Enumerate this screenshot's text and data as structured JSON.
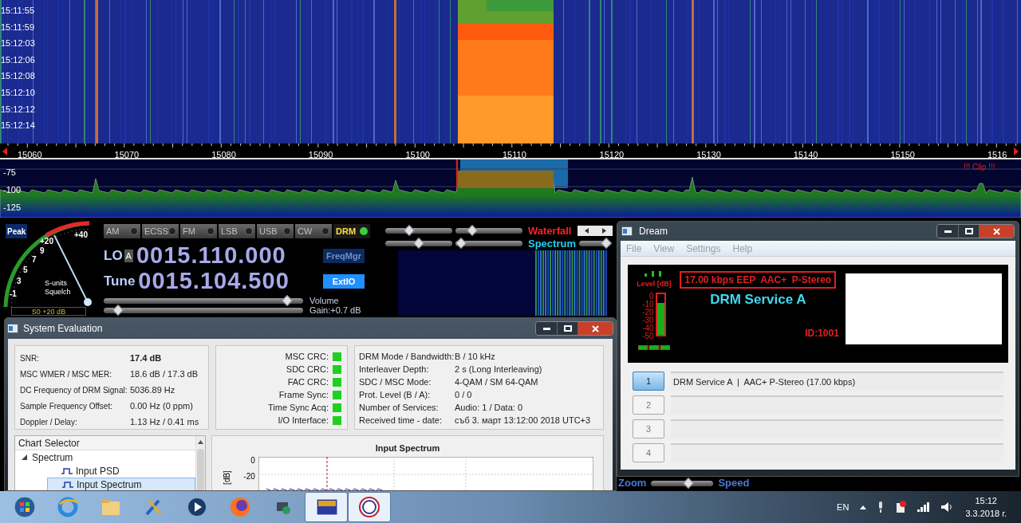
{
  "waterfall": {
    "times": [
      "15:11:55",
      "15:11:59",
      "15:12:03",
      "15:12:06",
      "15:12:08",
      "15:12:10",
      "15:12:12",
      "15:12:14"
    ]
  },
  "frequency_axis": {
    "labels": [
      "15060",
      "15070",
      "15080",
      "15090",
      "15100",
      "15110",
      "15120",
      "15130",
      "15140",
      "15150",
      "1516"
    ]
  },
  "spectrum": {
    "db_labels": [
      "-75",
      "-100",
      "-125"
    ],
    "clip_warning": "!!! Clip !!!"
  },
  "controls": {
    "peak_button": "Peak",
    "s_meter": {
      "scale": [
        "+40",
        "+20",
        "9",
        "7",
        "5",
        "3",
        "-1"
      ],
      "label": "S-units",
      "squelch": "Squelch",
      "reading": "S0 +20 dB"
    },
    "modes": [
      {
        "label": "AM",
        "selected": false
      },
      {
        "label": "ECSS",
        "selected": false
      },
      {
        "label": "FM",
        "selected": false
      },
      {
        "label": "LSB",
        "selected": false
      },
      {
        "label": "USB",
        "selected": false
      },
      {
        "label": "CW",
        "selected": false
      },
      {
        "label": "DRM",
        "selected": true
      }
    ],
    "lo": {
      "label": "LO",
      "bank": "A",
      "frequency": "0015.110.000"
    },
    "tune": {
      "label": "Tune",
      "frequency": "0015.104.500"
    },
    "freqmgr_button": "FreqMgr",
    "extio_button": "ExtIO",
    "volume": {
      "label": "Volume",
      "level": 0.92
    },
    "gain": {
      "label": "Gain:+0.7 dB",
      "level": 0.07
    },
    "waterfall_label": "Waterfall",
    "spectrum_label": "Spectrum",
    "waterfall_sliders": [
      {
        "level": 0.36
      },
      {
        "level": 0.25
      }
    ],
    "spectrum_sliders": [
      {
        "level": 0.5
      },
      {
        "level": 0.08
      }
    ],
    "speed_slider": {
      "level": 0.85
    },
    "zoom_label": "Zoom",
    "speed_label": "Speed",
    "zoom_slider": {
      "level": 0.6
    }
  },
  "system_evaluation": {
    "title": "System Evaluation",
    "stats": [
      {
        "label": "SNR:",
        "value": "17.4 dB",
        "bold": true
      },
      {
        "label": "MSC WMER / MSC MER:",
        "value": "18.6 dB / 17.3 dB",
        "bold": false
      },
      {
        "label": "DC Frequency of DRM Signal:",
        "value": "5036.89 Hz",
        "bold": false
      },
      {
        "label": "Sample Frequency Offset:",
        "value": "0.00 Hz (0 ppm)",
        "bold": false
      },
      {
        "label": "Doppler / Delay:",
        "value": "1.13 Hz / 0.41 ms",
        "bold": false
      }
    ],
    "checks": [
      {
        "label": "MSC CRC:",
        "ok": true
      },
      {
        "label": "SDC CRC:",
        "ok": true
      },
      {
        "label": "FAC CRC:",
        "ok": true
      },
      {
        "label": "Frame Sync:",
        "ok": true
      },
      {
        "label": "Time Sync Acq:",
        "ok": true
      },
      {
        "label": "I/O Interface:",
        "ok": true
      }
    ],
    "info": [
      {
        "label": "DRM Mode / Bandwidth:",
        "value": "B / 10 kHz"
      },
      {
        "label": "Interleaver Depth:",
        "value": "2 s (Long Interleaving)"
      },
      {
        "label": "SDC / MSC Mode:",
        "value": "4-QAM / SM 64-QAM"
      },
      {
        "label": "Prot. Level (B / A):",
        "value": "0 / 0"
      },
      {
        "label": "Number of Services:",
        "value": "Audio: 1 / Data: 0"
      },
      {
        "label": "Received time - date:",
        "value": "съб 3. март 13:12:00 2018 UTC+3"
      }
    ],
    "chart_selector": {
      "header": "Chart Selector",
      "tree": [
        {
          "label": "Spectrum",
          "expanded": true,
          "children": [
            {
              "label": "Input PSD",
              "selected": false
            },
            {
              "label": "Input Spectrum",
              "selected": true
            }
          ]
        }
      ]
    },
    "chart": {
      "title": "Input Spectrum",
      "ylabel": "[dB]",
      "yticks": [
        "0",
        "-20"
      ]
    }
  },
  "dream": {
    "title": "Dream",
    "menu": [
      "File",
      "View",
      "Settings",
      "Help"
    ],
    "display": {
      "level_label": "Level [dB]",
      "level_ticks": [
        "0",
        "-10",
        "-20",
        "-30",
        "-40",
        "-50"
      ],
      "level": 0.78,
      "service_info": "17.00 kbps EEP  AAC+  P-Stereo",
      "service_name": "DRM Service A",
      "id": "ID:1001"
    },
    "services": [
      {
        "number": "1",
        "selected": true,
        "text": "DRM Service A  |  AAC+ P-Stereo (17.00 kbps)"
      },
      {
        "number": "2",
        "selected": false
      },
      {
        "number": "3",
        "selected": false
      },
      {
        "number": "4",
        "selected": false
      }
    ]
  },
  "taskbar": {
    "apps": [
      {
        "kind": "start",
        "active": false
      },
      {
        "kind": "browser",
        "active": false
      },
      {
        "kind": "folder",
        "active": false
      },
      {
        "kind": "tools",
        "active": false
      },
      {
        "kind": "player",
        "active": false
      },
      {
        "kind": "fox",
        "active": false
      },
      {
        "kind": "network",
        "active": false
      },
      {
        "kind": "receiver",
        "active": true
      },
      {
        "kind": "dream",
        "active": true
      }
    ],
    "language": "EN",
    "time": "15:12",
    "date": "3.3.2018 г."
  }
}
